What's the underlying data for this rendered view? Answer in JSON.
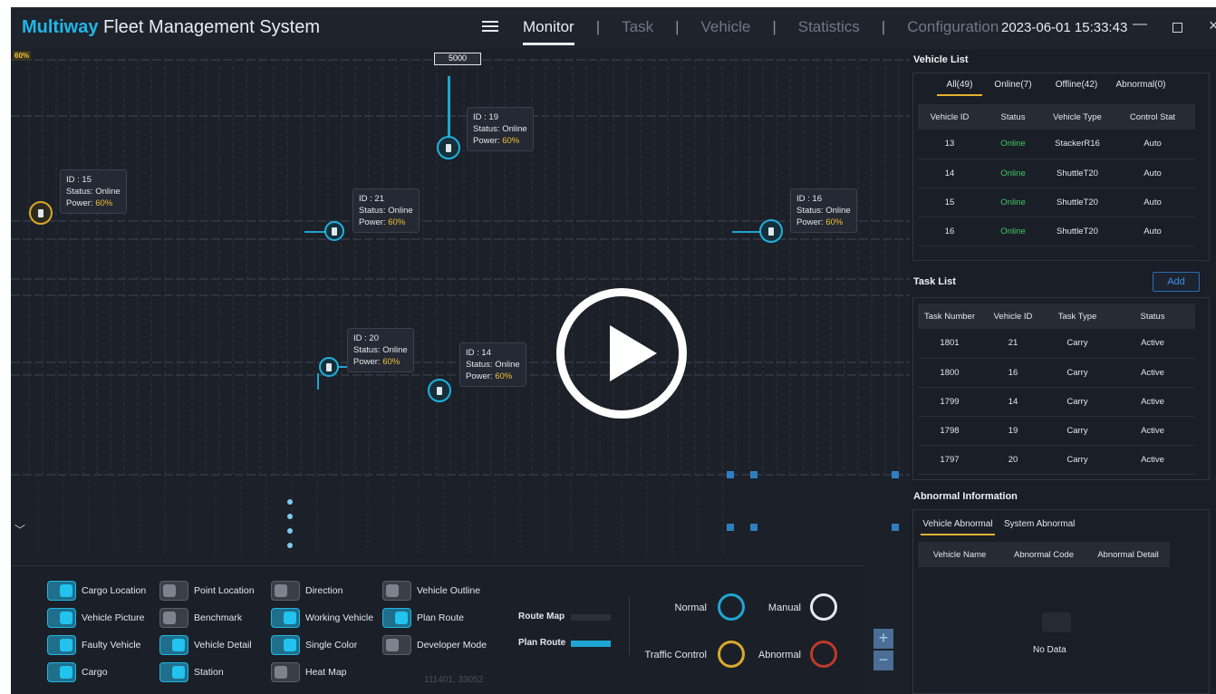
{
  "header": {
    "brand_accent": "Multiway",
    "brand_rest": " Fleet Management System",
    "nav": [
      "Monitor",
      "Task",
      "Vehicle",
      "Statistics",
      "Configuration"
    ],
    "datetime": "2023-06-01 15:33:43",
    "minimize": "—",
    "close": "×"
  },
  "map": {
    "corner_power": "60%",
    "top_label": "5000",
    "vehicles": [
      {
        "id_line": "ID  :  19",
        "status_line": "Status:  Online",
        "power_label": "Power:",
        "power": "60%",
        "color": "blue"
      },
      {
        "id_line": "ID  :  15",
        "status_line": "Status:  Online",
        "power_label": "Power:",
        "power": "60%",
        "color": "yellow"
      },
      {
        "id_line": "ID  :  21",
        "status_line": "Status:  Online",
        "power_label": "Power:",
        "power": "60%",
        "color": "blue"
      },
      {
        "id_line": "ID  :  16",
        "status_line": "Status:  Online",
        "power_label": "Power:",
        "power": "60%",
        "color": "blue"
      },
      {
        "id_line": "ID  :  20",
        "status_line": "Status:  Online",
        "power_label": "Power:",
        "power": "60%",
        "color": "blue"
      },
      {
        "id_line": "ID  :  14",
        "status_line": "Status:  Online",
        "power_label": "Power:",
        "power": "60%",
        "color": "blue"
      }
    ],
    "coords": "111401, 33052"
  },
  "controls": {
    "options": [
      {
        "label": "Cargo Location",
        "on": true
      },
      {
        "label": "Vehicle Picture",
        "on": true
      },
      {
        "label": "Faulty Vehicle",
        "on": true
      },
      {
        "label": "Cargo",
        "on": true
      },
      {
        "label": "Point Location",
        "on": false
      },
      {
        "label": "Benchmark",
        "on": false
      },
      {
        "label": "Vehicle Detail",
        "on": true
      },
      {
        "label": "Station",
        "on": true
      },
      {
        "label": "Direction",
        "on": false
      },
      {
        "label": "Working Vehicle",
        "on": true
      },
      {
        "label": "Single Color",
        "on": true
      },
      {
        "label": "Heat Map",
        "on": false
      },
      {
        "label": "Vehicle Outline",
        "on": false
      },
      {
        "label": "Plan Route",
        "on": true
      },
      {
        "label": "Developer Mode",
        "on": false
      }
    ],
    "route_map": "Route Map",
    "plan_route": "Plan Route",
    "route_map_color": "#2a3039",
    "plan_route_color": "#1fa6d2",
    "status": {
      "normal": "Normal",
      "manual": "Manual",
      "traffic_control": "Traffic Control",
      "abnormal": "Abnormal",
      "normal_color": "#1fa6d2",
      "manual_color": "#e6e9ee",
      "traffic_color": "#d9a82c",
      "abnormal_color": "#c0392b"
    },
    "zoom_in": "+",
    "zoom_out": "−"
  },
  "vehicle_list": {
    "title": "Vehicle List",
    "tabs": [
      "All(49)",
      "Online(7)",
      "Offline(42)",
      "Abnormal(0)"
    ],
    "columns": [
      "Vehicle ID",
      "Status",
      "Vehicle Type",
      "Control Stat"
    ],
    "rows": [
      [
        "13",
        "Online",
        "StackerR16",
        "Auto"
      ],
      [
        "14",
        "Online",
        "ShuttleT20",
        "Auto"
      ],
      [
        "15",
        "Online",
        "ShuttleT20",
        "Auto"
      ],
      [
        "16",
        "Online",
        "ShuttleT20",
        "Auto"
      ]
    ]
  },
  "task_list": {
    "title": "Task List",
    "add_label": "Add",
    "columns": [
      "Task Number",
      "Vehicle ID",
      "Task Type",
      "Status"
    ],
    "rows": [
      [
        "1801",
        "21",
        "Carry",
        "Active"
      ],
      [
        "1800",
        "16",
        "Carry",
        "Active"
      ],
      [
        "1799",
        "14",
        "Carry",
        "Active"
      ],
      [
        "1798",
        "19",
        "Carry",
        "Active"
      ],
      [
        "1797",
        "20",
        "Carry",
        "Active"
      ]
    ]
  },
  "abnormal": {
    "title": "Abnormal Information",
    "tabs": [
      "Vehicle Abnormal",
      "System Abnormal"
    ],
    "columns": [
      "Vehicle Name",
      "Abnormal Code",
      "Abnormal Detail"
    ],
    "empty": "No Data"
  }
}
